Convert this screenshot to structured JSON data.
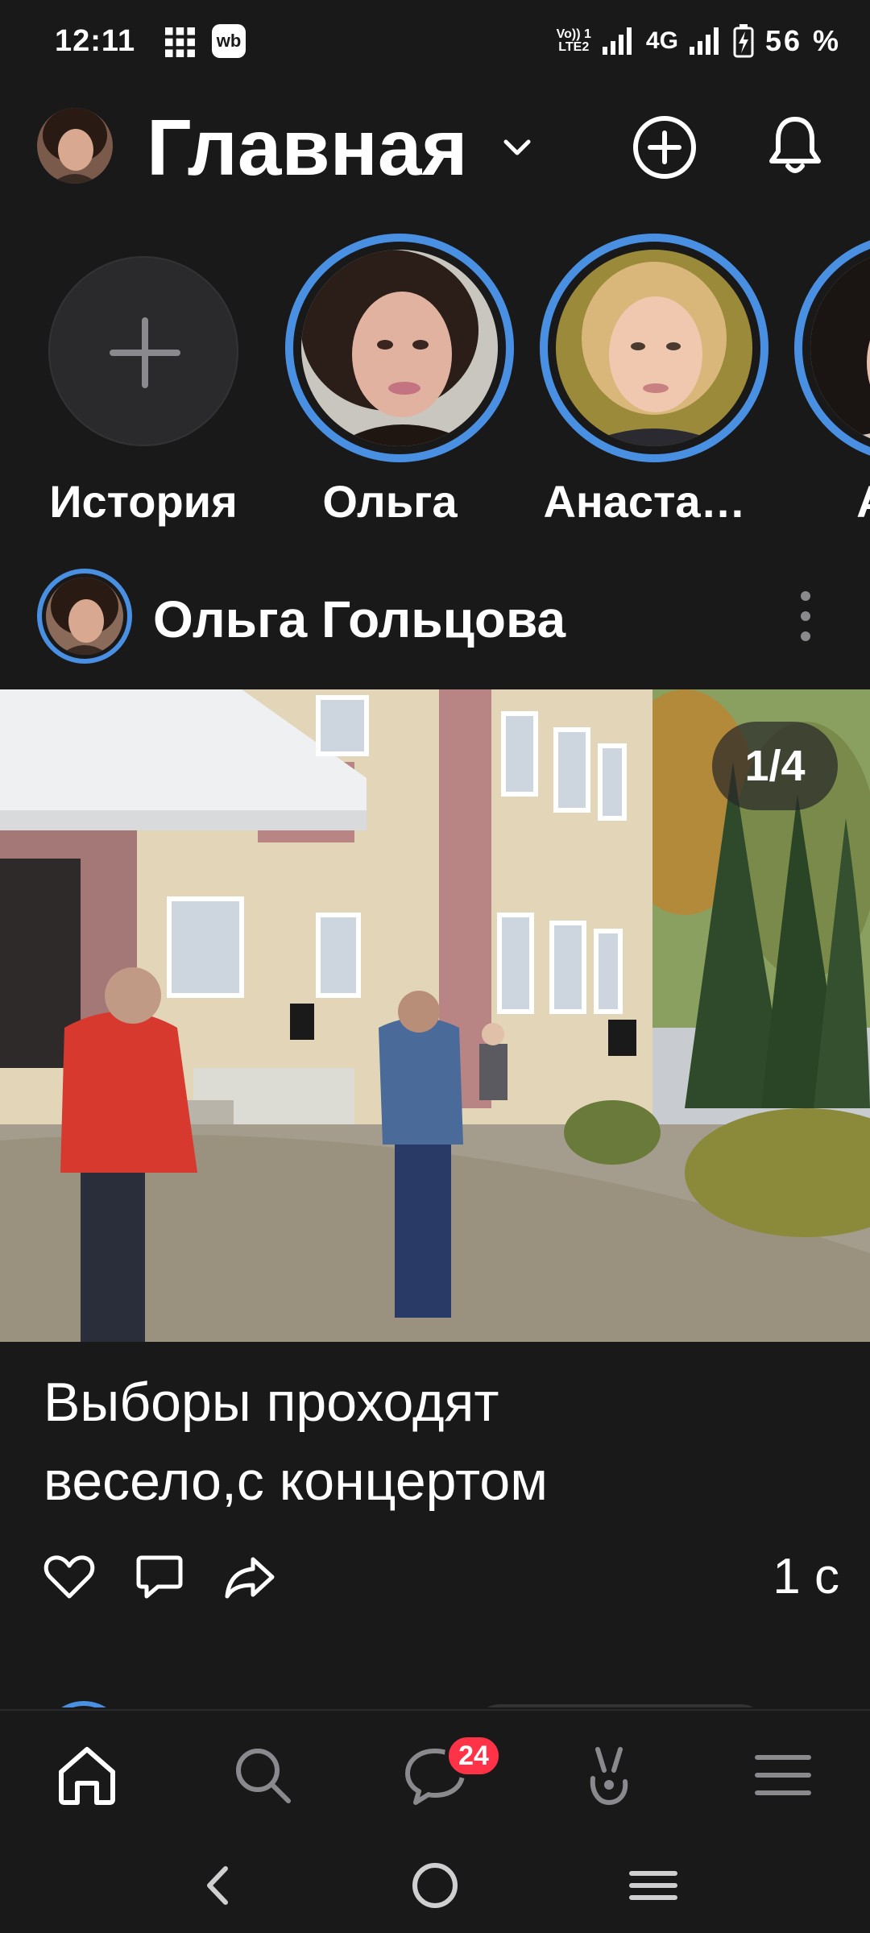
{
  "status_bar": {
    "time": "12:11",
    "wb_label": "wb",
    "volte_label": "Vo)) 1\nLTE2",
    "network": "4G",
    "battery": "56 %",
    "icons": [
      "grid-icon",
      "wb-icon",
      "volte-icon",
      "signal-icon",
      "signal-icon-2",
      "battery-charging-icon"
    ]
  },
  "header": {
    "title": "Главная",
    "icons": [
      "avatar",
      "chevron-down-icon",
      "plus-circle-icon",
      "bell-icon"
    ]
  },
  "stories": {
    "items": [
      {
        "label": "История",
        "type": "add"
      },
      {
        "label": "Ольга",
        "type": "story"
      },
      {
        "label": "Анаста…",
        "type": "story"
      },
      {
        "label": "Ana",
        "type": "story"
      }
    ]
  },
  "post": {
    "author": "Ольга Гольцова",
    "image_counter": "1/4",
    "text_line1": "Выборы проходят",
    "text_line2": "весело,с концертом",
    "time": "1 с",
    "actions": [
      "heart-icon",
      "comment-icon",
      "share-icon"
    ]
  },
  "bottom_nav": {
    "items": [
      "home-icon",
      "search-icon",
      "messages-icon",
      "clips-icon",
      "menu-icon"
    ],
    "messages_badge": "24"
  },
  "system_nav": {
    "items": [
      "back-icon",
      "home-circle-icon",
      "recents-icon"
    ]
  },
  "colors": {
    "background": "#19191a",
    "accent_ring": "#4a90e2",
    "badge": "#ff3347"
  }
}
